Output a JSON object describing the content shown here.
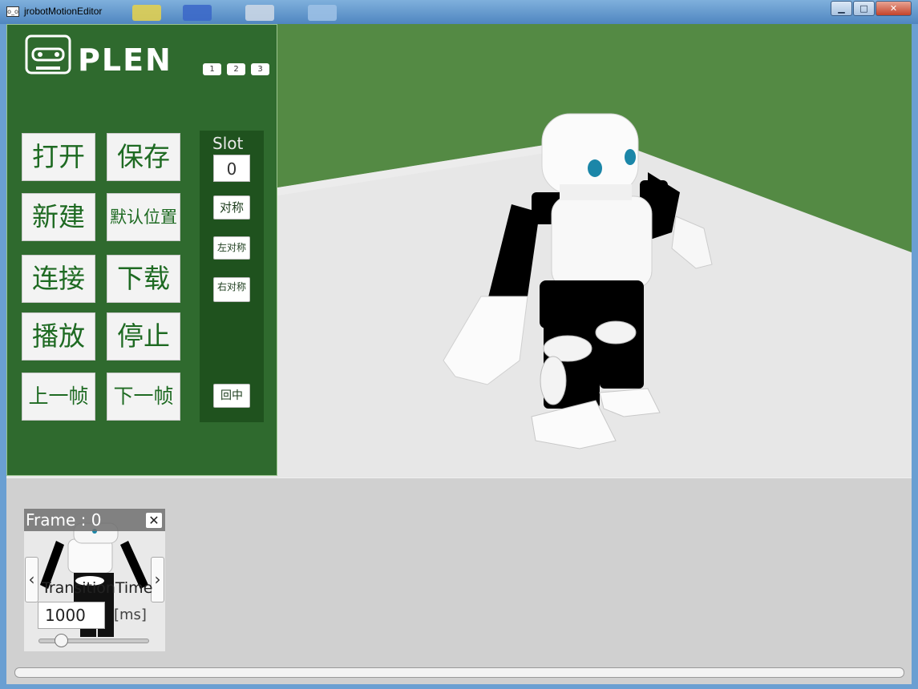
{
  "window": {
    "title": "jrobotMotionEditor",
    "app_icon_glyph": "o_o",
    "minimize": "▁",
    "maximize": "□",
    "close": "✕"
  },
  "logo": {
    "text": "PLEN"
  },
  "page_tabs": [
    "1",
    "2",
    "3"
  ],
  "buttons": {
    "open": "打开",
    "save": "保存",
    "new": "新建",
    "default_position": "默认位置",
    "connect": "连接",
    "download": "下载",
    "play": "播放",
    "stop": "停止",
    "prev_frame": "上一帧",
    "next_frame": "下一帧"
  },
  "slot": {
    "label": "Slot",
    "value": "0",
    "symmetric": "对称",
    "left_symmetric": "左对称",
    "right_symmetric": "右对称",
    "center": "回中"
  },
  "frame_card": {
    "header": "Frame :  0",
    "close": "✕",
    "left_arrow": "‹",
    "right_arrow": "›",
    "transition_label": "TransitionTime",
    "transition_value": "1000",
    "unit": "[ms]",
    "slider_fraction": 0.2
  },
  "colors": {
    "panel_green": "#2f6a2e",
    "slot_green": "#1f521e",
    "button_text_green": "#1e6a22",
    "sky_green": "#548a44",
    "floor": "#e6e6e6"
  }
}
